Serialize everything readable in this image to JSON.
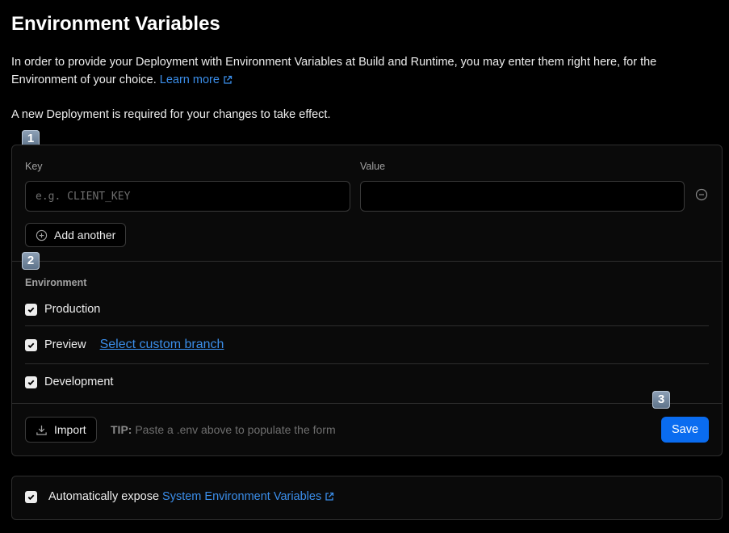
{
  "page": {
    "title": "Environment Variables",
    "description": "In order to provide your Deployment with Environment Variables at Build and Runtime, you may enter them right here, for the Environment of your choice.",
    "learn_more": "Learn more",
    "notice": "A new Deployment is required for your changes to take effect."
  },
  "badges": [
    "1",
    "2",
    "3"
  ],
  "form": {
    "key_label": "Key",
    "value_label": "Value",
    "key_placeholder": "e.g. CLIENT_KEY",
    "key_value": "",
    "value_value": "",
    "add_another": "Add another"
  },
  "environment": {
    "title": "Environment",
    "options": [
      {
        "label": "Production",
        "checked": true
      },
      {
        "label": "Preview",
        "checked": true
      },
      {
        "label": "Development",
        "checked": true
      }
    ],
    "custom_branch": "Select custom branch"
  },
  "footer": {
    "import": "Import",
    "tip_label": "TIP:",
    "tip_text": "Paste a .env above to populate the form",
    "save": "Save"
  },
  "expose": {
    "checked": true,
    "text": "Automatically expose",
    "link": "System Environment Variables"
  },
  "colors": {
    "accent": "#0a6cf0",
    "link": "#3b8eea",
    "background": "#000000"
  }
}
